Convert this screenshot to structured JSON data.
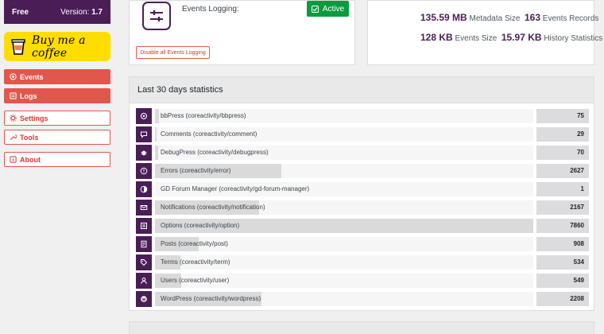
{
  "version_box": {
    "plan": "Free",
    "version_label": "Version:",
    "version": "1.7"
  },
  "coffee": {
    "label": "Buy me a coffee"
  },
  "nav": [
    {
      "label": "Events",
      "icon": "events-icon"
    },
    {
      "label": "Logs",
      "icon": "logs-icon"
    },
    {
      "label": "Settings",
      "icon": "gear-icon"
    },
    {
      "label": "Tools",
      "icon": "wrench-icon"
    },
    {
      "label": "About",
      "icon": "info-icon"
    }
  ],
  "logging": {
    "label": "Events Logging:",
    "status": "Active",
    "disable_label": "Disable all Events Logging"
  },
  "sizes": {
    "metadata_size_value": "135.59 MB",
    "metadata_size_label": "Metadata Size",
    "events_records_value": "163",
    "events_records_label": "Events Records",
    "events_size_value": "128 KB",
    "events_size_label": "Events Size",
    "history_value": "15.97 KB",
    "history_label": "History Statistics"
  },
  "stats": {
    "title": "Last 30 days statistics",
    "rows": [
      {
        "label": "bbPress (coreactivity/bbpress)",
        "count": "75",
        "value": 75,
        "icon": "bbpress-icon"
      },
      {
        "label": "Comments (coreactivity/comment)",
        "count": "29",
        "value": 29,
        "icon": "comment-icon"
      },
      {
        "label": "DebugPress (coreactivity/debugpress)",
        "count": "70",
        "value": 70,
        "icon": "bug-icon"
      },
      {
        "label": "Errors (coreactivity/error)",
        "count": "2627",
        "value": 2627,
        "icon": "error-icon"
      },
      {
        "label": "GD Forum Manager (coreactivity/gd-forum-manager)",
        "count": "1",
        "value": 1,
        "icon": "forum-icon"
      },
      {
        "label": "Notifications (coreactivity/notification)",
        "count": "2167",
        "value": 2167,
        "icon": "envelope-icon"
      },
      {
        "label": "Options (coreactivity/option)",
        "count": "7860",
        "value": 7860,
        "icon": "options-icon"
      },
      {
        "label": "Posts (coreactivity/post)",
        "count": "908",
        "value": 908,
        "icon": "post-icon"
      },
      {
        "label": "Terms (coreactivity/term)",
        "count": "534",
        "value": 534,
        "icon": "tag-icon"
      },
      {
        "label": "Users (coreactivity/user)",
        "count": "549",
        "value": 549,
        "icon": "user-icon"
      },
      {
        "label": "WordPress (coreactivity/wordpress)",
        "count": "2208",
        "value": 2208,
        "icon": "wordpress-icon"
      }
    ]
  },
  "colors": {
    "brand": "#4a1d57",
    "accent": "#e2574c",
    "active": "#0b9b3e",
    "coffee": "#ffdd00"
  }
}
